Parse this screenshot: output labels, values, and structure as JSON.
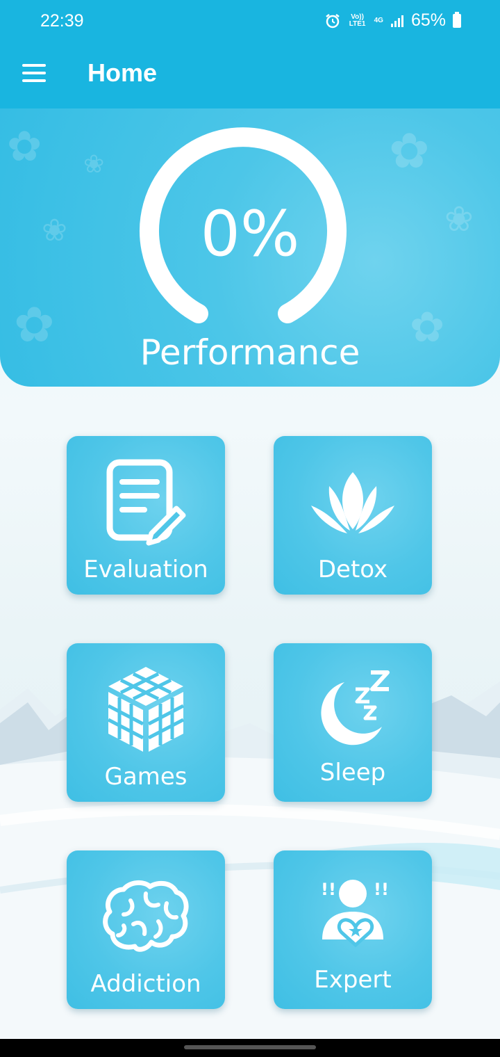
{
  "status_bar": {
    "time": "22:39",
    "volte_label": "Vo)) LTE1",
    "network_label": "4G",
    "battery": "65%"
  },
  "app_bar": {
    "title": "Home",
    "menu_icon": "hamburger-menu-icon"
  },
  "performance": {
    "value": 0,
    "display": "0%",
    "label": "Performance"
  },
  "tiles": [
    {
      "label": "Evaluation",
      "icon": "document-edit-icon"
    },
    {
      "label": "Detox",
      "icon": "lotus-icon"
    },
    {
      "label": "Games",
      "icon": "cube-icon"
    },
    {
      "label": "Sleep",
      "icon": "moon-zzz-icon"
    },
    {
      "label": "Addiction",
      "icon": "brain-icon"
    },
    {
      "label": "Expert",
      "icon": "expert-person-icon"
    }
  ],
  "colors": {
    "primary": "#19b5e0",
    "tile": "#4fc6e8",
    "text_on_primary": "#ffffff"
  }
}
